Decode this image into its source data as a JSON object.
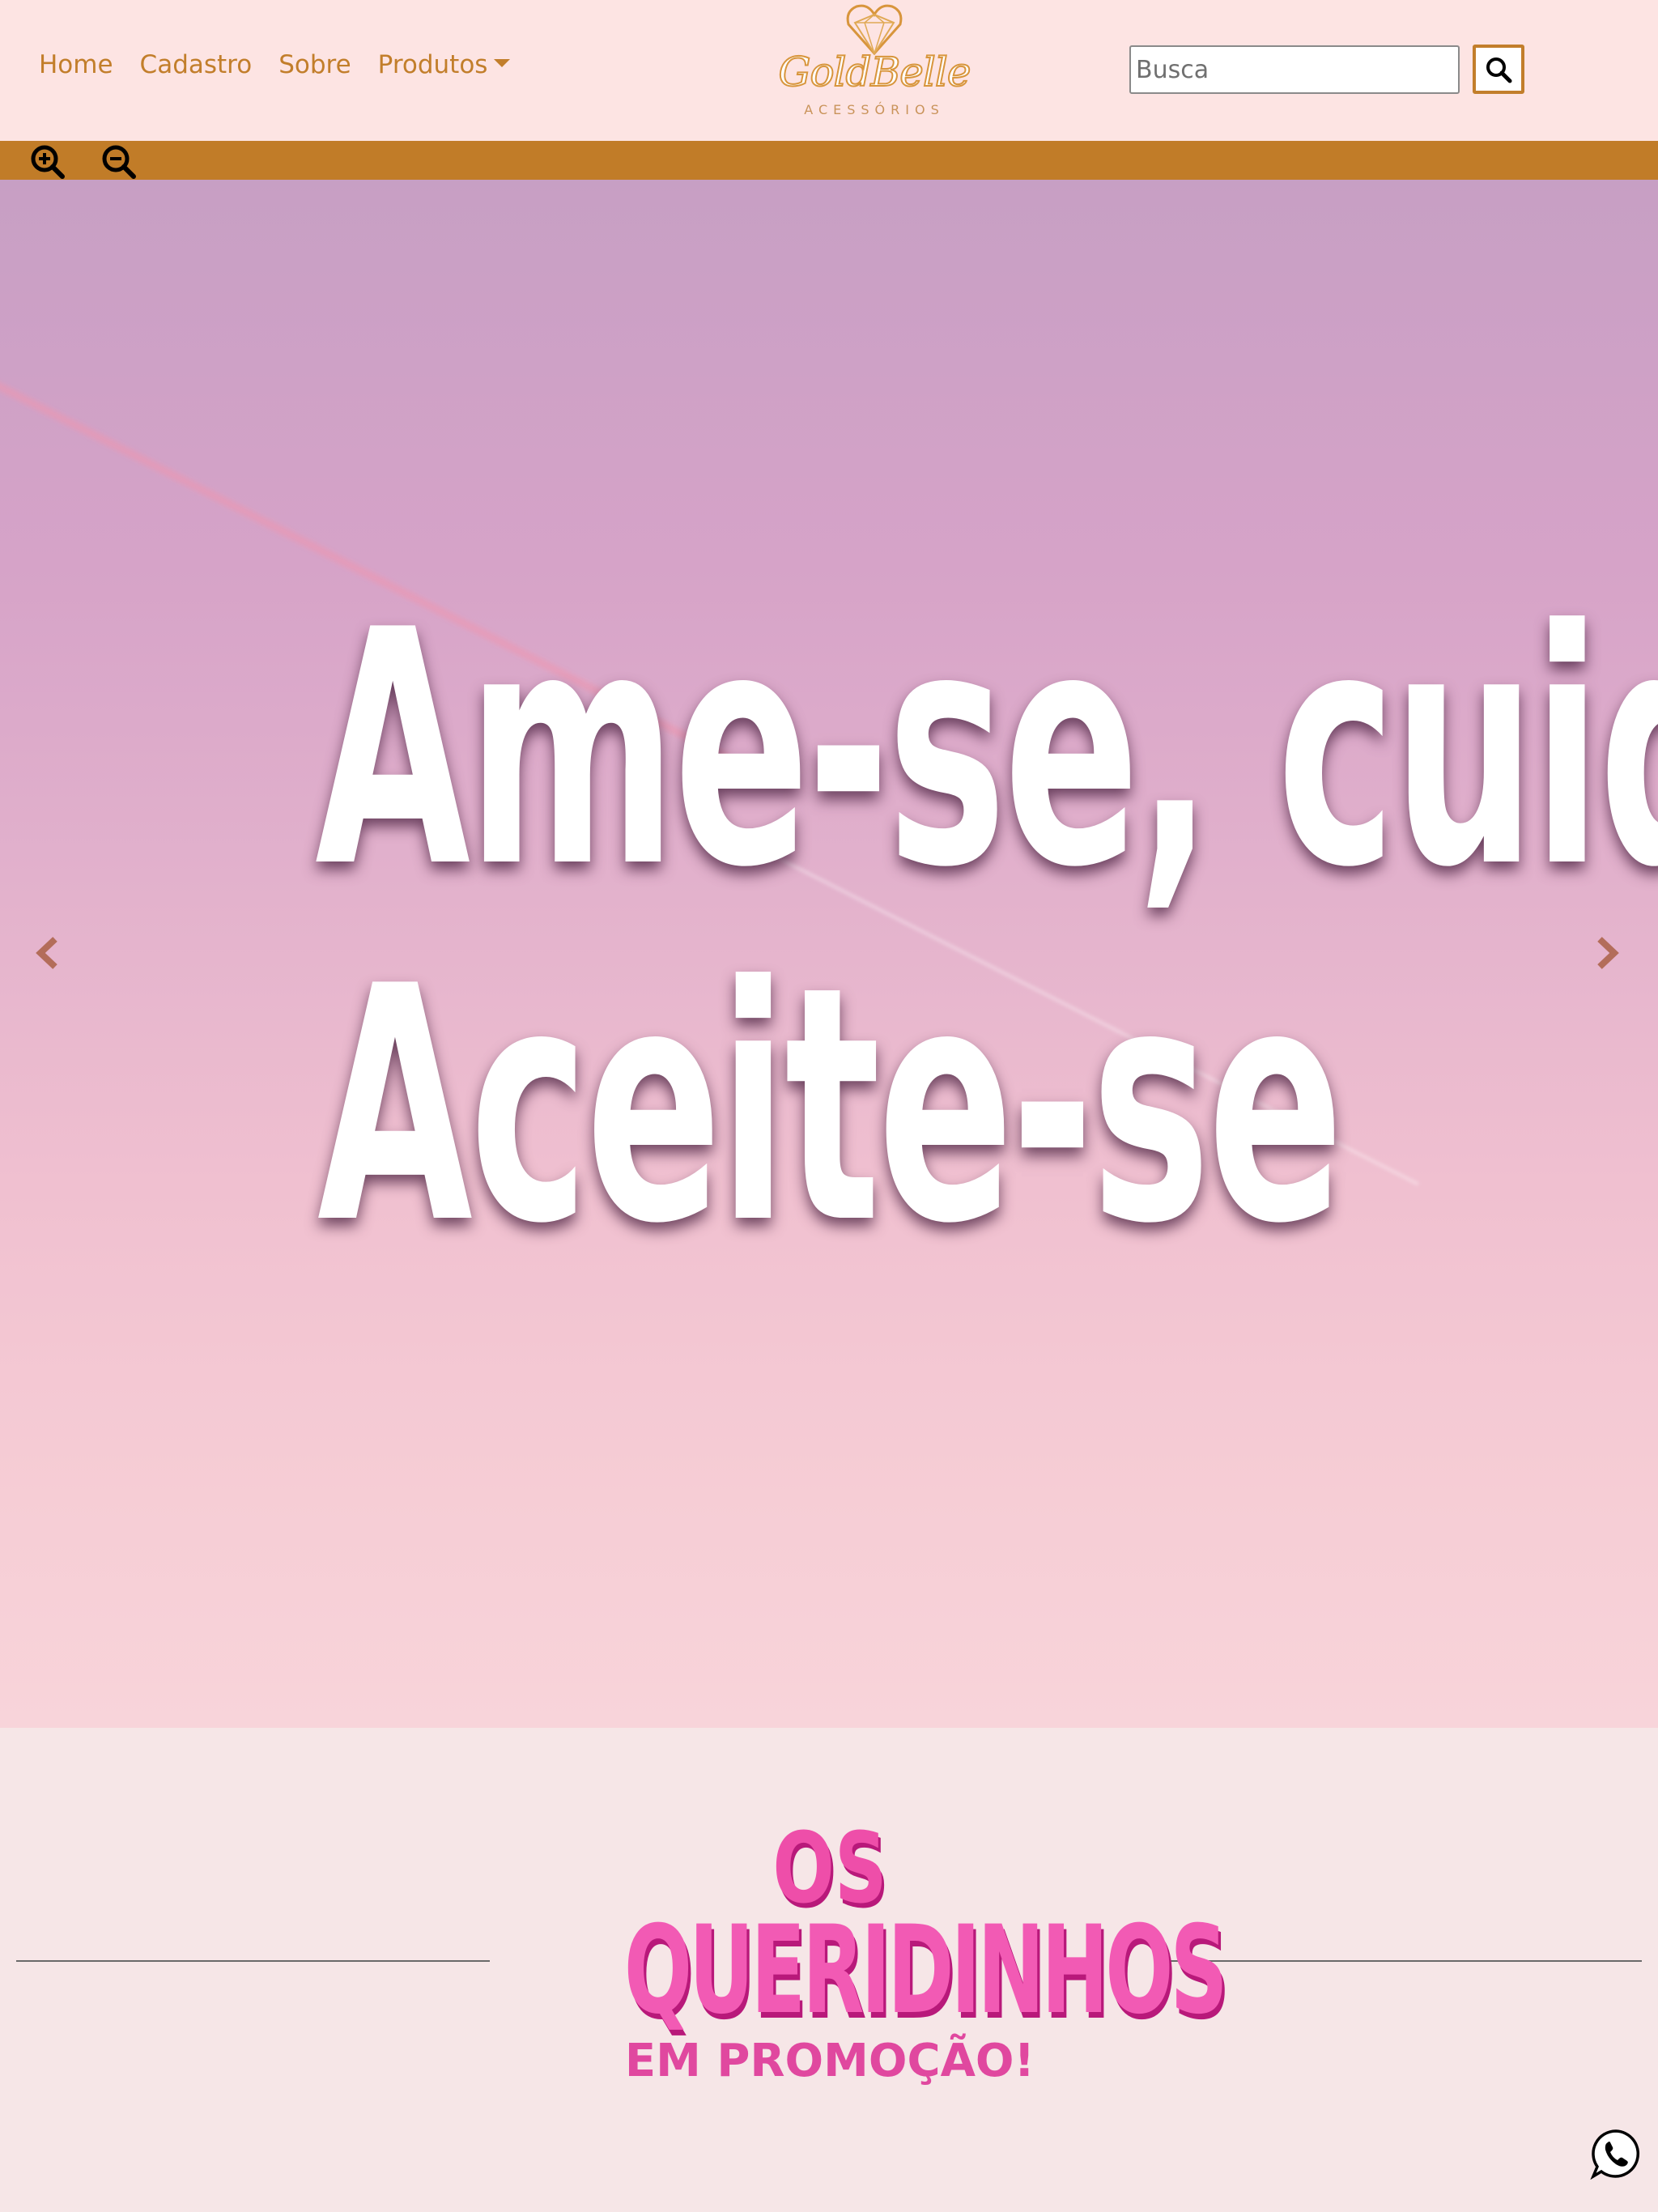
{
  "nav": {
    "links": [
      "Home",
      "Cadastro",
      "Sobre",
      "Produtos"
    ],
    "brand_name": "GoldBelle",
    "brand_sub": "ACESSÓRIOS"
  },
  "search": {
    "placeholder": "Busca",
    "value": ""
  },
  "icons": {
    "search": "search-icon",
    "zoom_in": "zoom-in-icon",
    "zoom_out": "zoom-out-icon",
    "prev": "chevron-left-icon",
    "next": "chevron-right-icon",
    "whatsapp": "whatsapp-icon",
    "caret": "caret-down-icon"
  },
  "hero": {
    "line1": "Ame-se, cuide-se,",
    "line2": "Aceite-se"
  },
  "promo": {
    "line1": "OS",
    "line2": "QUERIDINHOS",
    "line3": "EM PROMOÇÃO!"
  },
  "colors": {
    "brand_gold": "#c27e2b",
    "navbar_bg": "#fde4e3",
    "zoom_bar_bg": "#c17c28",
    "page_bg": "#f6e6e7",
    "promo_pink": "#f25ab4"
  }
}
